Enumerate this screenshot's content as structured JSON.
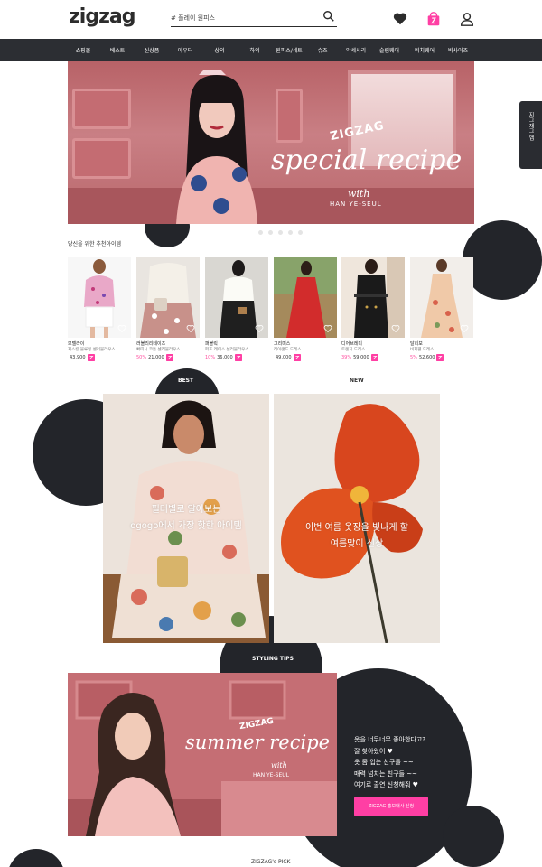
{
  "header": {
    "logo": "zigzag",
    "search_placeholder": "# 플레이 원피스"
  },
  "nav": [
    "쇼핑몰",
    "베스트",
    "신상품",
    "아우터",
    "상의",
    "하의",
    "원피스/세트",
    "슈즈",
    "악세사리",
    "슬림웨어",
    "비치웨어",
    "빅사이즈"
  ],
  "side_tab": "지그재그 앱",
  "hero": {
    "brand": "ZIGZAG",
    "title": "special recipe",
    "with": "with",
    "subtitle": "HAN YE-SEUL"
  },
  "recommended": {
    "title": "당신을 위한 추천아이템",
    "products": [
      {
        "shop": "모델라이",
        "name": "지스킹 블루밍 셀러블라우스",
        "discount": "",
        "price": "43,900"
      },
      {
        "shop": "러블리리데이즈",
        "name": "빠띠시 코튼 셀러블라우스",
        "discount": "50%",
        "price": "21,000"
      },
      {
        "shop": "퍼블릭",
        "name": "퍼프 레이스 셀러블라우스",
        "discount": "10%",
        "price": "36,000"
      },
      {
        "shop": "그리미스",
        "name": "레이랜드 드레스",
        "discount": "",
        "price": "49,000"
      },
      {
        "shop": "디어브레디",
        "name": "트렌치 드레스",
        "discount": "39%",
        "price": "59,000"
      },
      {
        "shop": "달리보",
        "name": "비치웬 드레스",
        "discount": "5%",
        "price": "52,600"
      }
    ]
  },
  "sections": {
    "best": "BEST",
    "new": "NEW",
    "best_card_text": [
      "필터별로 알아보는",
      "ogogo에서 가장 핫한 아이템"
    ],
    "new_card_text": [
      "이번 여름 옷장을 빛나게 할",
      "여름맞이 신상"
    ]
  },
  "styling": {
    "label": "STYLING TIPS",
    "brand": "ZIGZAG",
    "title": "summer recipe",
    "with": "with",
    "subtitle": "HAN YE-SEUL",
    "copy": [
      "옷을 너무너무 좋아한다고?",
      "잘 찾아왔어 ♥",
      "옷 좀 입는 친구들 ~~",
      "매력 넘치는 친구들 ~~",
      "여기로 출연 신청해줘 ♥"
    ],
    "cta": "ZIGZAG 홍보대사 신청"
  },
  "pick_label": "ZIGZAG's PICK",
  "colors": {
    "dark": "#23252a",
    "accent": "#ff3fa4",
    "nav_bg": "#2c2e33"
  }
}
